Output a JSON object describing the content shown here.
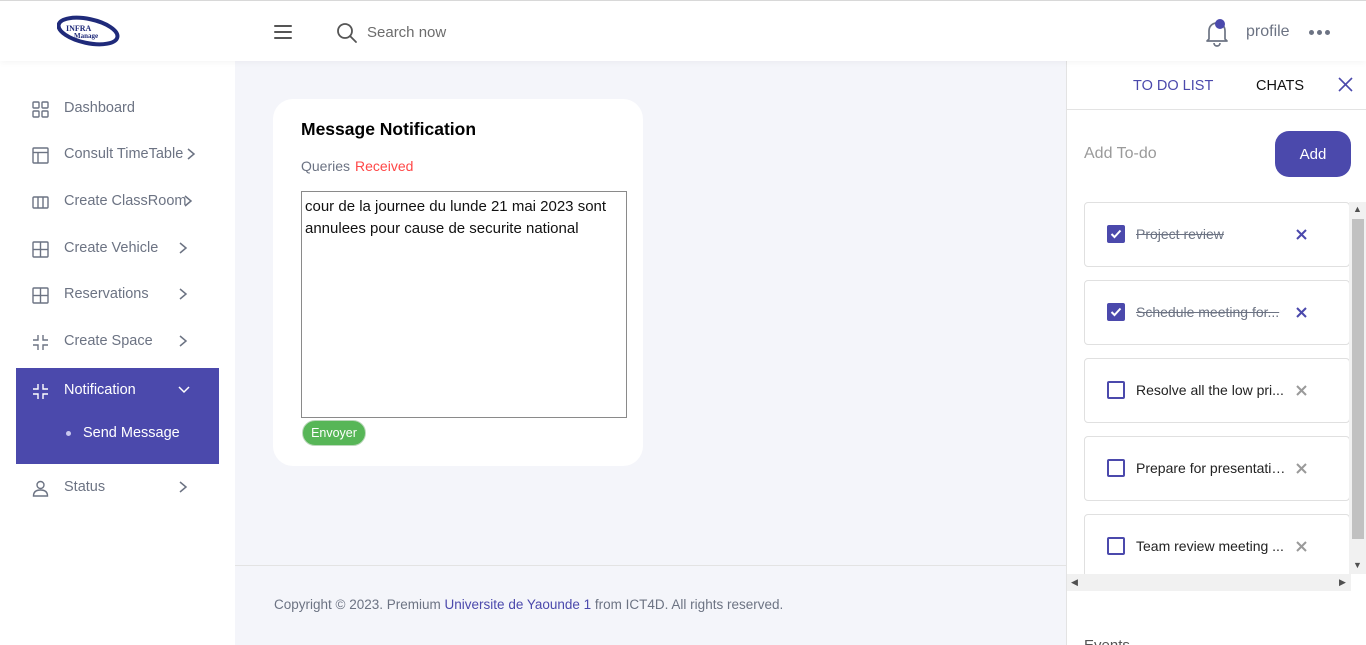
{
  "brand": {
    "logo_text_1": "INFRA",
    "logo_text_2": "Manage",
    "accent": "#4b49ac"
  },
  "header": {
    "search_placeholder": "Search now",
    "profile_label": "profile"
  },
  "sidebar": {
    "items": [
      {
        "label": "Dashboard",
        "icon": "dashboard-icon"
      },
      {
        "label": "Consult TimeTable",
        "icon": "layout-icon"
      },
      {
        "label": "Create ClassRoom",
        "icon": "columns-icon"
      },
      {
        "label": "Create Vehicle",
        "icon": "grid-icon"
      },
      {
        "label": "Reservations",
        "icon": "grid-icon"
      },
      {
        "label": "Create Space",
        "icon": "compress-icon"
      },
      {
        "label": "Notification",
        "icon": "compress-icon",
        "sub": [
          "Send Message"
        ]
      },
      {
        "label": "Status",
        "icon": "user-icon"
      }
    ]
  },
  "card": {
    "title": "Message Notification",
    "desc_prefix": "Queries",
    "desc_highlight": "Received",
    "message": "cour de la journee du lunde 21 mai 2023 sont annulees pour cause de securite national",
    "send_label": "Envoyer"
  },
  "footer": {
    "prefix": "Copyright © 2023. Premium",
    "link": "Universite de Yaounde 1",
    "suffix": "from ICT4D. All rights reserved."
  },
  "right_panel": {
    "tabs": [
      "TO DO LIST",
      "CHATS"
    ],
    "todo_placeholder": "Add To-do",
    "add_label": "Add",
    "todos": [
      {
        "text": "Project review",
        "done": true
      },
      {
        "text": "Schedule meeting for...",
        "done": true
      },
      {
        "text": "Resolve all the low pri...",
        "done": false
      },
      {
        "text": "Prepare for presentation",
        "done": false
      },
      {
        "text": "Team review meeting ...",
        "done": false
      }
    ],
    "events_label": "Events"
  }
}
